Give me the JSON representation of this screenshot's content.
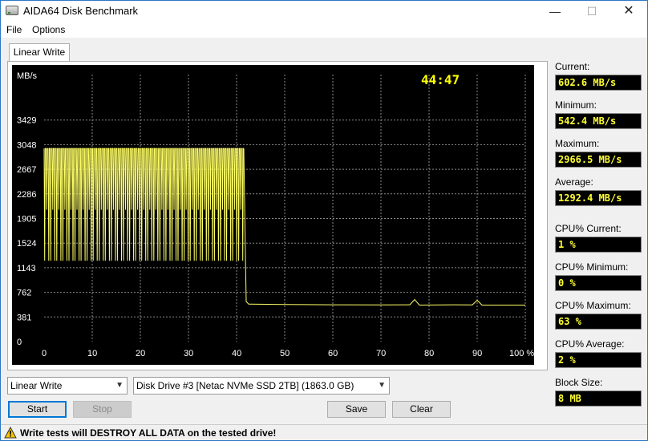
{
  "window": {
    "title": "AIDA64 Disk Benchmark"
  },
  "menu": {
    "items": [
      "File",
      "Options"
    ]
  },
  "tab": {
    "label": "Linear Write"
  },
  "chart_data": {
    "type": "line",
    "y_unit_label": "MB/s",
    "timer": "44:47",
    "yticks": [
      0,
      381,
      762,
      1143,
      1524,
      1905,
      2286,
      2667,
      3048,
      3429
    ],
    "xticks": [
      "0",
      "10",
      "20",
      "30",
      "40",
      "50",
      "60",
      "70",
      "80",
      "90",
      "100 %"
    ],
    "xlim": [
      0,
      100
    ],
    "ylim": [
      0,
      3810
    ],
    "grid": true,
    "line_color": "#ffff66",
    "series": [
      {
        "segment": "oscillating_write_phase",
        "x_range": [
          0,
          41.5
        ],
        "high_value": 2990,
        "low_value": 1250,
        "mid_value": 2040
      },
      {
        "segment": "drop",
        "x": [
          41.5,
          41.8,
          42.0,
          42.5
        ],
        "y": [
          2990,
          1480,
          620,
          580
        ]
      },
      {
        "segment": "steady_phase",
        "x": [
          42.5,
          50,
          60,
          70,
          76,
          77,
          78,
          85,
          89,
          90,
          91,
          100
        ],
        "y": [
          580,
          575,
          570,
          568,
          570,
          650,
          565,
          570,
          568,
          640,
          565,
          565
        ]
      }
    ]
  },
  "stats": {
    "current_label": "Current:",
    "current_value": "602.6 MB/s",
    "minimum_label": "Minimum:",
    "minimum_value": "542.4 MB/s",
    "maximum_label": "Maximum:",
    "maximum_value": "2966.5 MB/s",
    "average_label": "Average:",
    "average_value": "1292.4 MB/s",
    "cpu_current_label": "CPU% Current:",
    "cpu_current_value": "1 %",
    "cpu_minimum_label": "CPU% Minimum:",
    "cpu_minimum_value": "0 %",
    "cpu_maximum_label": "CPU% Maximum:",
    "cpu_maximum_value": "63 %",
    "cpu_average_label": "CPU% Average:",
    "cpu_average_value": "2 %",
    "block_size_label": "Block Size:",
    "block_size_value": "8 MB"
  },
  "controls": {
    "test_select": "Linear Write",
    "drive_select": "Disk Drive #3  [Netac NVMe SSD 2TB]  (1863.0 GB)",
    "start": "Start",
    "stop": "Stop",
    "save": "Save",
    "clear": "Clear"
  },
  "status": {
    "warning": "Write tests will DESTROY ALL DATA on the tested drive!"
  }
}
